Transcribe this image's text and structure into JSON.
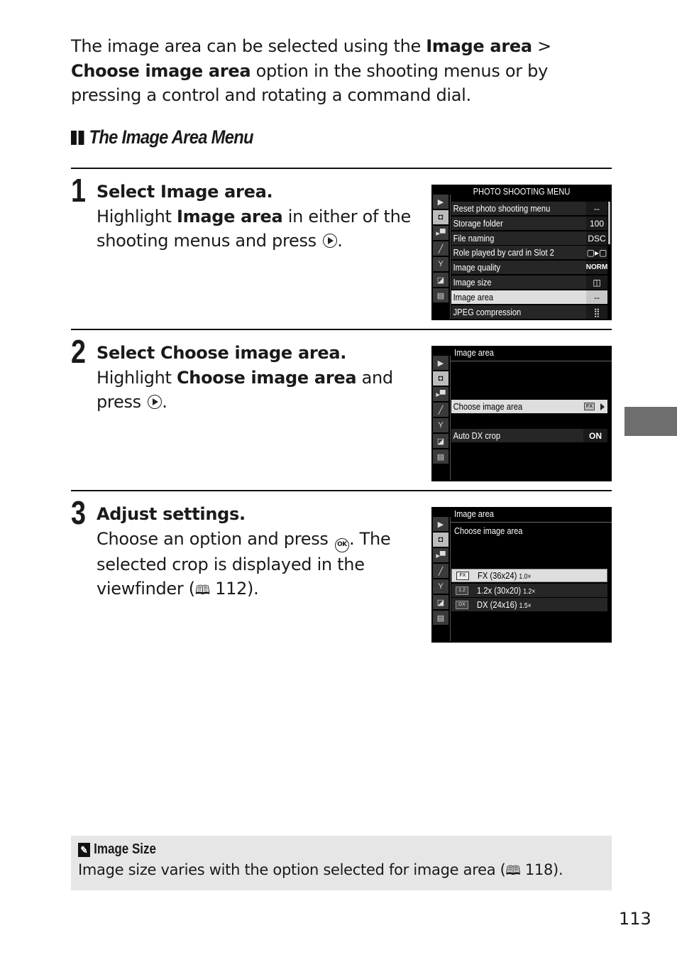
{
  "intro": {
    "part1": "The image area can be selected using the ",
    "bold1": "Image area",
    "sep": " > ",
    "bold2": "Choose image area",
    "part2": " option in the shooting menus or by pressing a control and rotating a command dial."
  },
  "section_title": "The Image Area Menu",
  "steps": [
    {
      "number": "1",
      "title": "Select Image area.",
      "pre": "Highlight ",
      "bold": "Image area",
      "post": " in either of the shooting menus and press ",
      "end": "."
    },
    {
      "number": "2",
      "title": "Select Choose image area.",
      "pre": "Highlight ",
      "bold": "Choose image area",
      "post": " and press ",
      "end": "."
    },
    {
      "number": "3",
      "title": "Adjust settings.",
      "pre": "Choose an option and press ",
      "ok_label": "OK",
      "post": ".  The selected crop is displayed in the viewfinder (",
      "page_ref": "112",
      "end": ")."
    }
  ],
  "screens": {
    "menu": {
      "title": "PHOTO SHOOTING MENU",
      "rail_icons": [
        "playback-icon",
        "camera-icon",
        "movie-icon",
        "pencil-icon",
        "wrench-icon",
        "retouch-icon",
        "my-menu-icon"
      ],
      "items": [
        {
          "label": "Reset photo shooting menu",
          "value": "--"
        },
        {
          "label": "Storage folder",
          "value": "100"
        },
        {
          "label": "File naming",
          "value": "DSC"
        },
        {
          "label": "Role played by card in Slot 2",
          "value": "▢▸▢"
        },
        {
          "label": "Image quality",
          "value": "NORM"
        },
        {
          "label": "Image size",
          "value": "◫"
        },
        {
          "label": "Image area",
          "value": "--",
          "selected": true
        },
        {
          "label": "JPEG compression",
          "value": "⣿"
        }
      ]
    },
    "image_area": {
      "title": "Image area",
      "items": [
        {
          "label": "Choose image area",
          "value": "FX",
          "selected": true
        },
        {
          "label": "Auto DX crop",
          "value": "ON"
        }
      ]
    },
    "choose_area": {
      "title": "Image area",
      "subtitle": "Choose image area",
      "options": [
        {
          "icon": "FX",
          "label": "FX    (36x24)",
          "factor": "1.0×",
          "selected": true
        },
        {
          "icon": "1.2",
          "label": "1.2x (30x20)",
          "factor": "1.2×"
        },
        {
          "icon": "DX",
          "label": "DX   (24x16)",
          "factor": "1.5×"
        }
      ]
    }
  },
  "note": {
    "title": "Image Size",
    "body_pre": "Image size varies with the option selected for image area (",
    "page_ref": "118",
    "body_post": ")."
  },
  "page_number": "113",
  "colors": {
    "thumb_tab": "#6e6e6e",
    "note_bg": "#e6e6e6",
    "highlight_row": "#dedede"
  }
}
